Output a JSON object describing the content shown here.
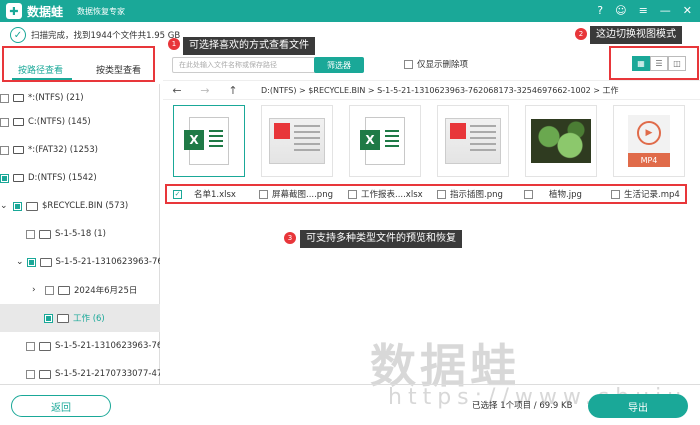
{
  "titlebar": {
    "logo_char": "✚",
    "brand": "数据蛙",
    "app_title": "数据恢复专家",
    "controls": [
      "?",
      "☺",
      "≡",
      "—",
      "✕"
    ]
  },
  "scan_status": "扫描完成，找到1944个文件共1.95 GB",
  "annotations": [
    {
      "num": "1",
      "text": "可选择喜欢的方式查看文件"
    },
    {
      "num": "2",
      "text": "这边切换视图模式"
    },
    {
      "num": "3",
      "text": "可支持多种类型文件的预览和恢复"
    }
  ],
  "tabs": {
    "by_path": "按路径查看",
    "by_type": "按类型查看"
  },
  "tree": [
    {
      "label": "*:(NTFS) (21)",
      "kind": "drive",
      "check": "none"
    },
    {
      "label": "C:(NTFS) (145)",
      "kind": "drive",
      "check": "none"
    },
    {
      "label": "*:(FAT32) (1253)",
      "kind": "drive",
      "check": "none"
    },
    {
      "label": "D:(NTFS) (1542)",
      "kind": "drive",
      "check": "partial"
    },
    {
      "label": "$RECYCLE.BIN (573)",
      "kind": "folder",
      "check": "partial",
      "chev": "v"
    },
    {
      "label": "S-1-5-18 (1)",
      "kind": "folder",
      "check": "none"
    },
    {
      "label": "S-1-5-21-1310623963-76",
      "kind": "folder",
      "check": "partial",
      "chev": "v"
    },
    {
      "label": "2024年6月25日",
      "kind": "folder",
      "check": "none",
      "chev": ">"
    },
    {
      "label": "工作 (6)",
      "kind": "folder",
      "check": "partial"
    },
    {
      "label": "S-1-5-21-1310623963-76",
      "kind": "folder",
      "check": "none"
    },
    {
      "label": "S-1-5-21-2170733077-47",
      "kind": "folder",
      "check": "none"
    }
  ],
  "search": {
    "placeholder": "在此处输入文件名称或保存路径"
  },
  "filter_button": "筛选器",
  "only_deleted": "仅显示删除项",
  "path": "D:(NTFS) > $RECYCLE.BIN > S-1-5-21-1310623963-762068173-3254697662-1002 > 工作",
  "files": [
    {
      "name": "名单1.xlsx",
      "checked": true
    },
    {
      "name": "屏幕截图....png",
      "checked": false
    },
    {
      "name": "工作报表....xlsx",
      "checked": false
    },
    {
      "name": "指示插图.png",
      "checked": false
    },
    {
      "name": "植物.jpg",
      "checked": false
    },
    {
      "name": "生活记录.mp4",
      "checked": false
    }
  ],
  "thumb_labels": {
    "mp4": "MP4"
  },
  "watermark": {
    "brand": "数据蛙",
    "url": "https://www.shuju"
  },
  "bottom": {
    "back": "返回",
    "selection": "已选择 1个项目 / 69.9 KB",
    "export": "导出"
  },
  "colors": {
    "accent": "#1aa898",
    "annotation_red": "#e8363a"
  }
}
